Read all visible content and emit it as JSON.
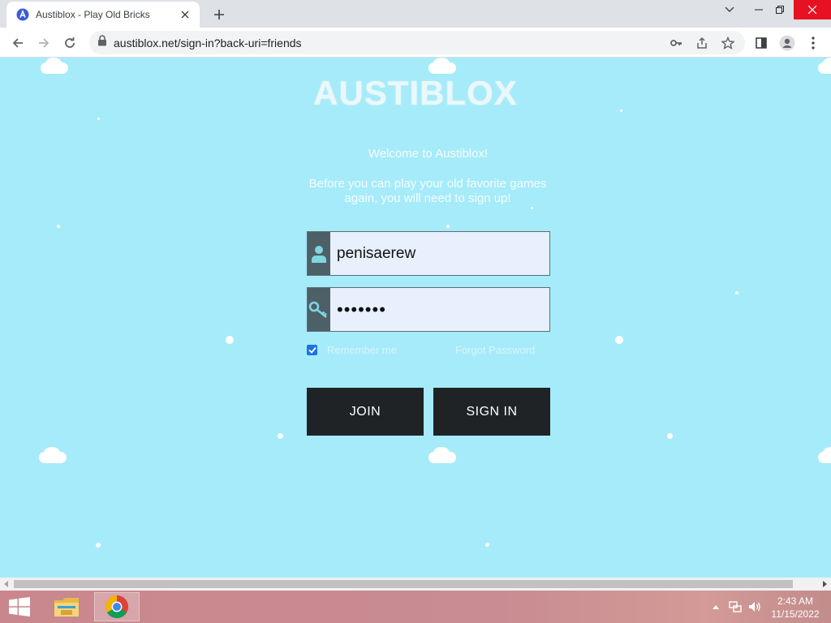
{
  "browser": {
    "tab_title": "Austiblox - Play Old Bricks",
    "url": "austiblox.net/sign-in?back-uri=friends"
  },
  "page": {
    "logo": "AUSTIBLOX",
    "welcome": "Welcome to Austiblox!",
    "intro": "Before you can play your old favorite games again, you will need to sign up!",
    "username_value": "penisaerew",
    "password_value": "•••••••",
    "remember_label": "Remember me",
    "remember_checked": true,
    "forgot_label": "Forgot Password",
    "join_label": "JOIN",
    "signin_label": "SIGN IN"
  },
  "taskbar": {
    "time": "2:43 AM",
    "date": "11/15/2022"
  },
  "colors": {
    "page_background": "#a6ebf9",
    "button_background": "#1f2326",
    "field_icon_background": "#4d6068",
    "field_background": "#e8f0fe",
    "close_button": "#e81123"
  },
  "icons": [
    "austiblox-favicon",
    "close-icon",
    "plus-icon",
    "chevron-down-icon",
    "minimize-icon",
    "restore-icon",
    "back-arrow-icon",
    "forward-arrow-icon",
    "reload-icon",
    "lock-icon",
    "key-icon",
    "share-icon",
    "star-icon",
    "side-panel-icon",
    "profile-icon",
    "kebab-menu-icon",
    "user-icon",
    "checkbox-icon",
    "windows-start-icon",
    "file-explorer-icon",
    "chrome-icon",
    "tray-up-arrow-icon",
    "network-icon",
    "volume-icon"
  ]
}
